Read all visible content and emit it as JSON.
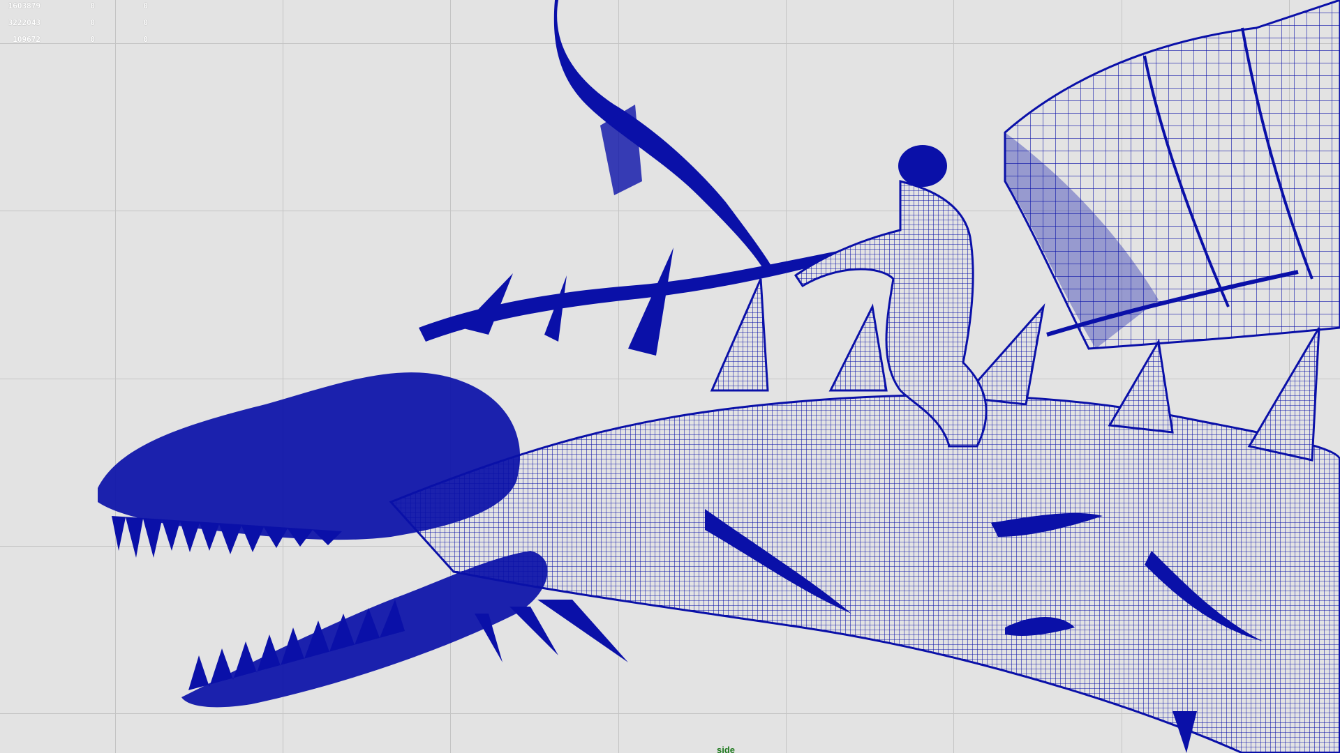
{
  "viewport": {
    "camera_name": "side",
    "background_color": "#e3e3e3",
    "grid_color": "#c4c4c4",
    "wireframe_color": "#0a10a8",
    "camera_label_color": "#1f7a1f"
  },
  "hud": {
    "rows": [
      {
        "values": [
          "1603879",
          "0",
          "0"
        ]
      },
      {
        "values": [
          "3222043",
          "0",
          "0"
        ]
      },
      {
        "values": [
          "109672",
          "0",
          "0"
        ]
      }
    ]
  },
  "scene": {
    "objects": [
      "dragon-wireframe",
      "rider-wireframe",
      "wing-wireframe"
    ]
  }
}
